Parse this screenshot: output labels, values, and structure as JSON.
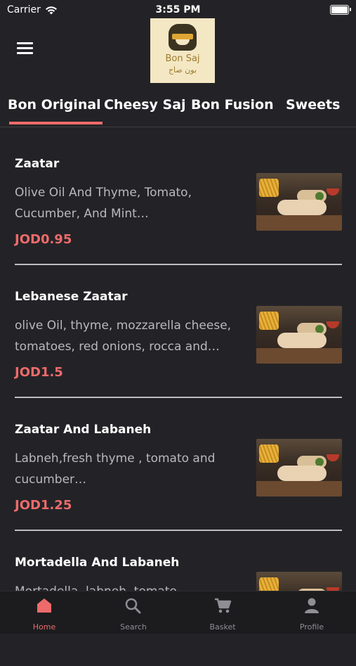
{
  "status_bar": {
    "carrier": "Carrier",
    "time": "3:55 PM"
  },
  "brand": {
    "logo_text_en": "Bon Saj",
    "logo_text_ar": "بون صاج"
  },
  "tabs": [
    {
      "label": "Bon Original",
      "active": true
    },
    {
      "label": "Cheesy Saj",
      "active": false
    },
    {
      "label": "Bon Fusion",
      "active": false
    },
    {
      "label": "Sweets",
      "active": false
    }
  ],
  "items": [
    {
      "name": "Zaatar",
      "desc": "Olive Oil And Thyme, Tomato, Cucumber, And Mint…",
      "price": "JOD0.95"
    },
    {
      "name": "Lebanese Zaatar",
      "desc": "olive Oil, thyme, mozzarella cheese, tomatoes, red onions, rocca and…",
      "price": "JOD1.5"
    },
    {
      "name": "Zaatar And Labaneh",
      "desc": "Labneh,fresh thyme , tomato and cucumber…",
      "price": "JOD1.25"
    },
    {
      "name": "Mortadella And Labaneh",
      "desc": "Mortadella, labneh, tomato",
      "price": ""
    }
  ],
  "tabbar": [
    {
      "label": "Home",
      "icon": "home-icon",
      "active": true
    },
    {
      "label": "Search",
      "icon": "search-icon",
      "active": false
    },
    {
      "label": "Basket",
      "icon": "basket-icon",
      "active": false
    },
    {
      "label": "Profile",
      "icon": "profile-icon",
      "active": false
    }
  ],
  "colors": {
    "accent": "#ed6b6b",
    "background": "#232327",
    "tabbar": "#1c1c1f"
  }
}
